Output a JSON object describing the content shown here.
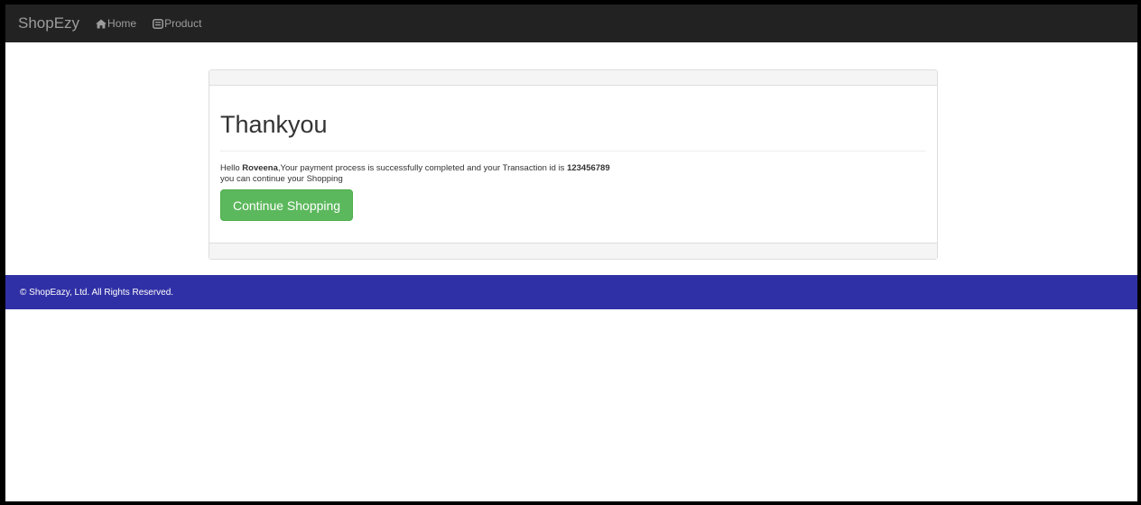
{
  "nav": {
    "brand": "ShopEzy",
    "home_label": "Home",
    "home_icon": "home-icon",
    "product_label": "Product",
    "product_icon": "product-icon"
  },
  "panel": {
    "title": "Thankyou",
    "greeting_prefix": "Hello ",
    "customer_name": "Roveena",
    "message": ",Your payment process is successfully completed and your Transaction id is ",
    "transaction_id": "123456789",
    "message_line2": "you can continue your Shopping",
    "button_label": "Continue Shopping"
  },
  "footer": {
    "text": "© ShopEazy, Ltd. All Rights Reserved."
  },
  "colors": {
    "navbar": "#222222",
    "button": "#5cb85c",
    "footer": "#3030a6"
  }
}
